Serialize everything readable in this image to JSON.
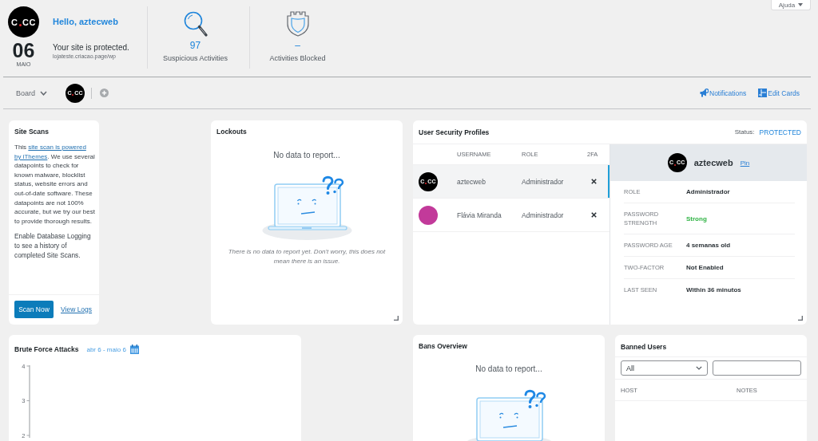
{
  "help_button": {
    "label": "Ajuda"
  },
  "header": {
    "avatar": {
      "kind": "logo",
      "before": "C",
      "after": "CC"
    },
    "greeting": "Hello, aztecweb",
    "date": {
      "day": "06",
      "month": "MAIO"
    },
    "status": "Your site is protected.",
    "site_url": "lojateste.criacao.page/wp",
    "stats": [
      {
        "kind": "suspicious",
        "value": "97",
        "label": "Suspicious Activities"
      },
      {
        "kind": "blocked",
        "value": "–",
        "label": "Activities Blocked"
      }
    ]
  },
  "toolbar": {
    "board": "Board",
    "avatar": {
      "kind": "logo",
      "before": "C",
      "after": "CC"
    },
    "actions": [
      {
        "kind": "notifications",
        "label": "Notifications"
      },
      {
        "kind": "edit_cards",
        "label": "Edit Cards"
      }
    ]
  },
  "site_scans": {
    "title": "Site Scans",
    "text_before": "This ",
    "link_lines": [
      "site scan is powered",
      "by iThemes"
    ],
    "text_after": ". We use several datapoints to check for known malware, blocklist status, website errors and out-of-date software. These datapoints are not 100% accurate, but we try our best to provide thorough results.",
    "note": "Enable Database Logging to see a history of completed Site Scans.",
    "scan_button": "Scan Now",
    "logs_link": "View Logs"
  },
  "lockouts": {
    "title": "Lockouts",
    "empty_title": "No data to report...",
    "empty_message": "There is no data to report yet. Don't worry, this does not mean there is an issue."
  },
  "user_profiles": {
    "title": "User Security Profiles",
    "status_label": "Status:",
    "status_value": "PROTECTED",
    "columns": [
      "USERNAME",
      "ROLE",
      "2FA"
    ],
    "users": [
      {
        "avatar": {
          "kind": "logo",
          "before": "C",
          "after": "CC"
        },
        "username": "aztecweb",
        "role": "Administrador",
        "two_factor": false,
        "selected": true
      },
      {
        "avatar": {
          "kind": "photo"
        },
        "username": "Flávia Miranda",
        "role": "Administrador",
        "two_factor": false,
        "selected": false
      }
    ],
    "detail": {
      "avatar": {
        "kind": "logo",
        "before": "C",
        "after": "CC"
      },
      "username": "aztecweb",
      "pin_link": "Pin",
      "fields": [
        {
          "kind": "plain",
          "label": "ROLE",
          "value": "Administrador"
        },
        {
          "kind": "strength",
          "label": "PASSWORD STRENGTH",
          "value": "Strong"
        },
        {
          "kind": "plain",
          "label": "PASSWORD AGE",
          "value": "4 semanas old"
        },
        {
          "kind": "plain",
          "label": "TWO-FACTOR",
          "value": "Not Enabled"
        },
        {
          "kind": "plain",
          "label": "LAST SEEN",
          "value": "Within 36 minutos"
        }
      ]
    }
  },
  "brute_force": {
    "title": "Brute Force Attacks",
    "date_range": "abr 6 - maio 6",
    "y_axis_labels": [
      "4",
      "3",
      "2"
    ]
  },
  "bans_overview": {
    "title": "Bans Overview",
    "empty_title": "No data to report..."
  },
  "banned_users": {
    "title": "Banned Users",
    "filter": {
      "value": "All"
    },
    "columns": [
      "HOST",
      "NOTES"
    ]
  }
}
